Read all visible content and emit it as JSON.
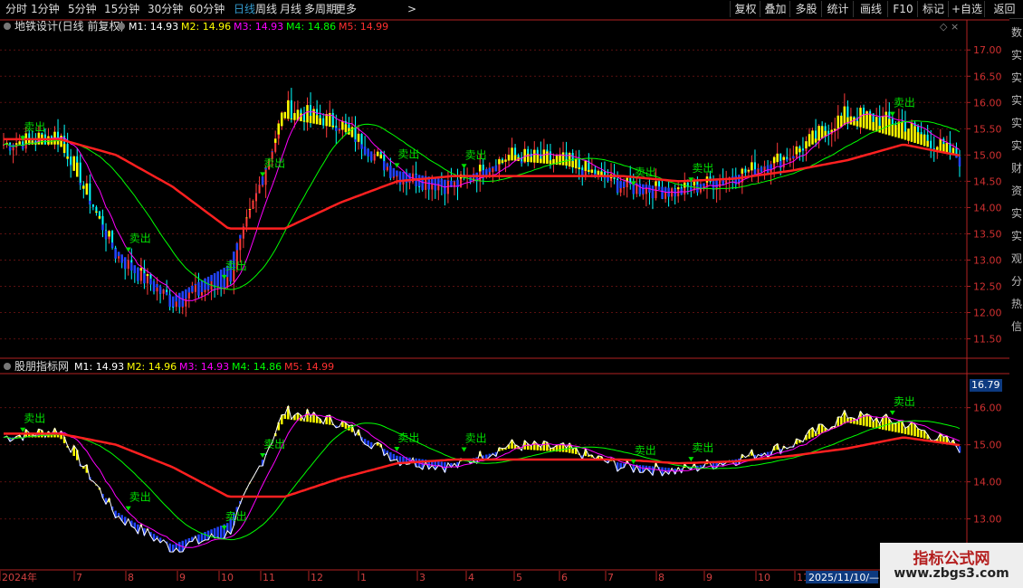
{
  "toolbar": {
    "left_items": [
      "分时",
      "1分钟",
      "5分钟",
      "15分钟",
      "30分钟",
      "60分钟",
      "日线",
      "周线",
      "月线",
      "多周期",
      "更多"
    ],
    "active_item": "日线",
    "more_arrow": ">",
    "right_items": [
      "复权",
      "叠加",
      "多股",
      "统计",
      "画线",
      "F10",
      "标记",
      "+自选",
      "返回"
    ]
  },
  "upper_panel": {
    "title": "地铁设计(日线 前复权)",
    "ma_labels": [
      {
        "label": "M1: 14.93",
        "color": "#ffffff"
      },
      {
        "label": "M2: 14.96",
        "color": "#ffff00"
      },
      {
        "label": "M3: 14.93",
        "color": "#ff00ff"
      },
      {
        "label": "M4: 14.86",
        "color": "#00ff00"
      },
      {
        "label": "M5: 14.99",
        "color": "#ff3030"
      }
    ],
    "y_ticks": [
      "17.00",
      "16.50",
      "16.00",
      "15.50",
      "15.00",
      "14.50",
      "14.00",
      "13.50",
      "13.00",
      "12.50",
      "12.00",
      "11.50"
    ]
  },
  "lower_panel": {
    "title": "股朋指标网",
    "ma_labels": [
      {
        "label": "M1: 14.93",
        "color": "#ffffff"
      },
      {
        "label": "M2: 14.96",
        "color": "#ffff00"
      },
      {
        "label": "M3: 14.93",
        "color": "#ff00ff"
      },
      {
        "label": "M4: 14.86",
        "color": "#00ff00"
      },
      {
        "label": "M5: 14.99",
        "color": "#ff3030"
      }
    ],
    "y_ticks": [
      "16.00",
      "15.00",
      "14.00",
      "13.00"
    ],
    "current_value": "16.79"
  },
  "signal_label": "卖出",
  "x_axis": {
    "labels": [
      "2024年",
      "7",
      "8",
      "9",
      "10",
      "11",
      "12",
      "1",
      "3",
      "4",
      "5",
      "6",
      "7",
      "8",
      "9",
      "10",
      "11"
    ],
    "cursor_date": "2025/11/10/—"
  },
  "sidebar_chars": [
    "数",
    "实",
    "实",
    "实",
    "实",
    "实",
    "财",
    "资",
    "实",
    "实",
    "观",
    "分",
    "热",
    "信"
  ],
  "watermark": {
    "title": "指标公式网",
    "url": "www.zbgs3.com"
  },
  "colors": {
    "up": "#ff3a3a",
    "down": "#00ffff",
    "ma1": "#ffffff",
    "ma2": "#ffff00",
    "ma3": "#ff00ff",
    "ma4": "#00ff00",
    "ma5": "#ff2020",
    "signal": "#00e000",
    "band_blue": "#2244ff",
    "axis": "#b22222"
  },
  "chart_data": {
    "type": "line",
    "title": "地铁设计(日线 前复权)",
    "x": [
      "2024-06",
      "2024-07",
      "2024-08",
      "2024-09",
      "2024-10",
      "2024-11",
      "2024-12",
      "2025-01",
      "2025-02",
      "2025-03",
      "2025-04",
      "2025-05",
      "2025-06",
      "2025-07",
      "2025-08",
      "2025-09",
      "2025-10",
      "2025-11"
    ],
    "series": [
      {
        "name": "M1",
        "values": [
          15.2,
          15.4,
          13.1,
          12.2,
          12.6,
          15.9,
          15.6,
          14.6,
          14.4,
          15.0,
          14.9,
          14.4,
          14.3,
          14.6,
          15.0,
          15.8,
          15.6,
          14.93
        ]
      },
      {
        "name": "M2",
        "values": [
          15.2,
          15.2,
          13.2,
          12.3,
          12.9,
          15.7,
          15.5,
          14.7,
          14.5,
          14.9,
          14.8,
          14.5,
          14.35,
          14.6,
          14.95,
          15.6,
          15.3,
          14.96
        ]
      },
      {
        "name": "M5",
        "values": [
          15.3,
          15.3,
          15.0,
          14.4,
          13.6,
          13.6,
          14.1,
          14.5,
          14.6,
          14.6,
          14.6,
          14.6,
          14.5,
          14.55,
          14.7,
          14.9,
          15.2,
          14.99
        ]
      }
    ],
    "signals": [
      "卖出",
      "卖出",
      "卖出",
      "卖出",
      "卖出",
      "卖出",
      "卖出",
      "卖出",
      "卖出"
    ],
    "ylim_upper": [
      11.2,
      17.4
    ],
    "ylim_lower": [
      12.6,
      16.7
    ],
    "grid": true
  }
}
